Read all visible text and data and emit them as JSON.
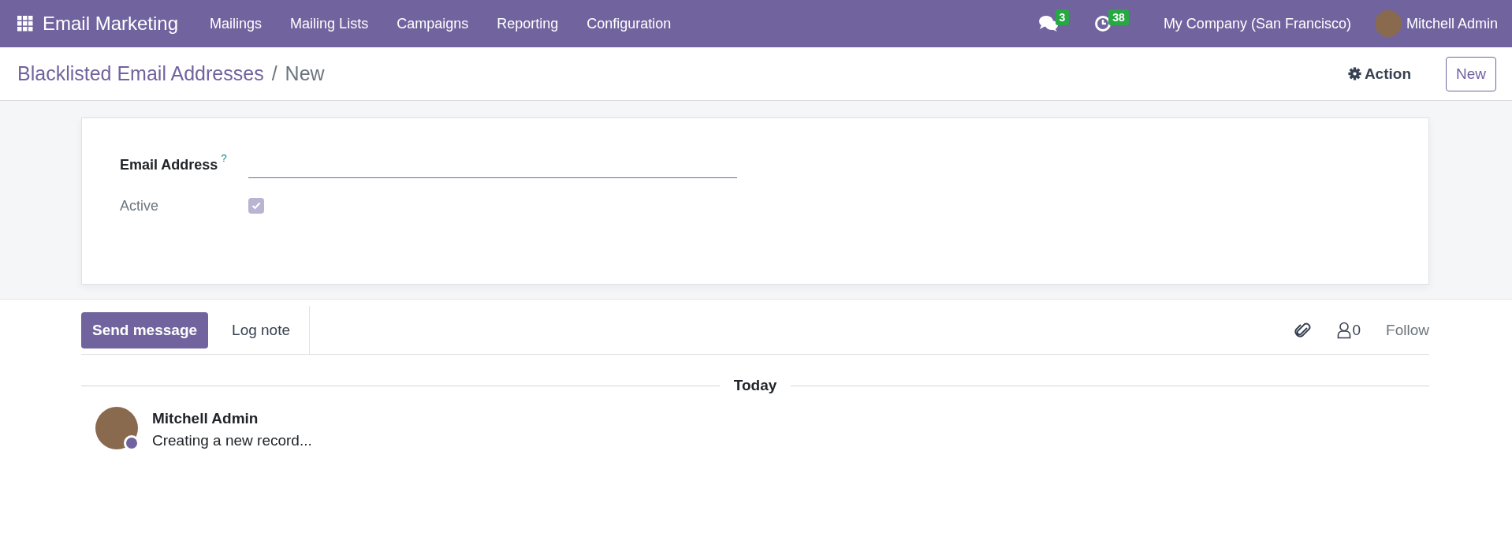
{
  "navbar": {
    "app_name": "Email Marketing",
    "menu": [
      {
        "label": "Mailings"
      },
      {
        "label": "Mailing Lists"
      },
      {
        "label": "Campaigns"
      },
      {
        "label": "Reporting"
      },
      {
        "label": "Configuration"
      }
    ],
    "messages_count": "3",
    "activities_count": "38",
    "company": "My Company (San Francisco)",
    "user": "Mitchell Admin"
  },
  "breadcrumb": {
    "parent": "Blacklisted Email Addresses",
    "separator": "/",
    "current": "New"
  },
  "actions": {
    "action": "Action",
    "new": "New"
  },
  "form": {
    "fields": [
      {
        "kind": "text",
        "label": "Email Address",
        "help": "?"
      },
      {
        "kind": "checkbox",
        "label": "Active",
        "checked": true,
        "disabled": true
      }
    ]
  },
  "chatter": {
    "send_message": "Send message",
    "log_note": "Log note",
    "followers_count": "0",
    "follow": "Follow",
    "date_separator": "Today",
    "messages": [
      {
        "author": "Mitchell Admin",
        "body": "Creating a new record..."
      }
    ]
  }
}
